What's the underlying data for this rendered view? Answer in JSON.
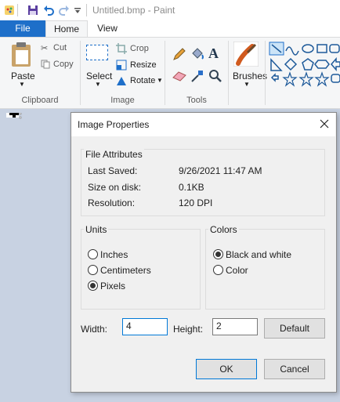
{
  "window": {
    "title": "Untitled.bmp - Paint"
  },
  "ribbon": {
    "tabs": [
      "File",
      "Home",
      "View"
    ],
    "clipboard": {
      "paste": "Paste",
      "cut": "Cut",
      "copy": "Copy",
      "label": "Clipboard"
    },
    "image": {
      "select": "Select",
      "crop": "Crop",
      "resize": "Resize",
      "rotate": "Rotate",
      "label": "Image"
    },
    "tools": {
      "label": "Tools"
    },
    "brushes": {
      "label": "Brushes"
    }
  },
  "dialog": {
    "title": "Image Properties",
    "file_attributes": {
      "legend": "File Attributes",
      "rows": [
        {
          "label": "Last Saved:",
          "value": "9/26/2021 11:47 AM"
        },
        {
          "label": "Size on disk:",
          "value": "0.1KB"
        },
        {
          "label": "Resolution:",
          "value": "120 DPI"
        }
      ]
    },
    "units": {
      "legend": "Units",
      "options": [
        "Inches",
        "Centimeters",
        "Pixels"
      ],
      "selected": "Pixels"
    },
    "colors": {
      "legend": "Colors",
      "options": [
        "Black and white",
        "Color"
      ],
      "selected": "Black and white"
    },
    "width": {
      "label": "Width:",
      "value": "4"
    },
    "height": {
      "label": "Height:",
      "value": "2"
    },
    "buttons": {
      "default": "Default",
      "ok": "OK",
      "cancel": "Cancel"
    }
  },
  "colors": {
    "accent": "#1e6fc9",
    "canvas_bg": "#c8d2e2",
    "focus": "#0078d7"
  }
}
